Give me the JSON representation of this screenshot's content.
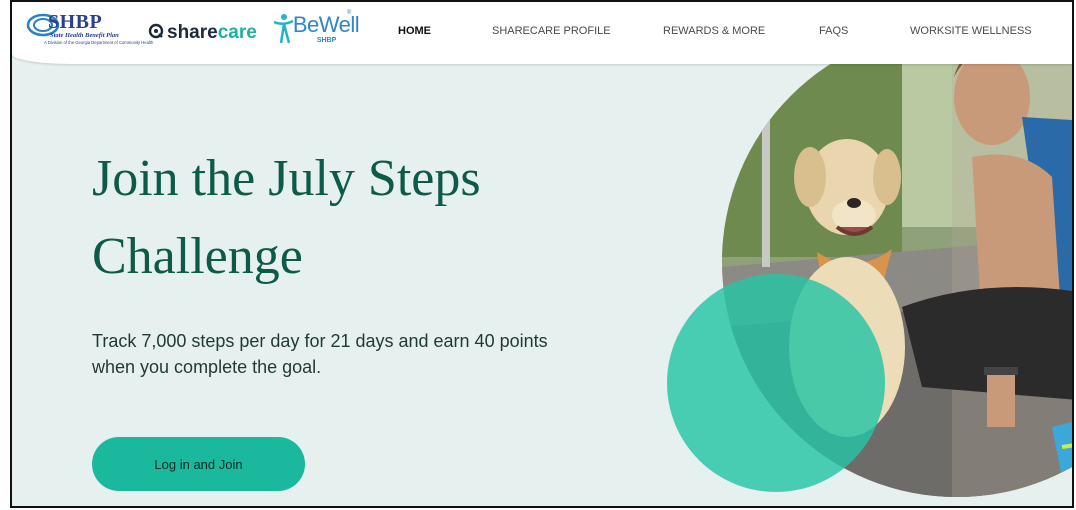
{
  "logos": {
    "shbp": "SHBP",
    "shbp_subtitle": "State Health Benefit Plan",
    "shbp_division": "A Division of the Georgia Department of Community Health",
    "sharecare_share": "share",
    "sharecare_care": "care",
    "bewell": "BeWell",
    "bewell_tag": "SHBP"
  },
  "nav": {
    "home": "HOME",
    "sharecare_profile": "SHARECARE PROFILE",
    "rewards": "REWARDS & MORE",
    "faqs": "FAQS",
    "worksite": "WORKSITE WELLNESS"
  },
  "hero": {
    "title": "Join the July Steps Challenge",
    "text": "Track 7,000 steps per day for 21 days and earn 40 points when you complete the goal.",
    "cta_label": "Log in and Join"
  },
  "colors": {
    "brand_green": "#0e5a49",
    "accent_teal": "#1ab89d",
    "background": "#e6f0ee"
  },
  "icons": [
    "shbp-logo-icon",
    "sharecare-logo-icon",
    "bewell-logo-icon"
  ]
}
